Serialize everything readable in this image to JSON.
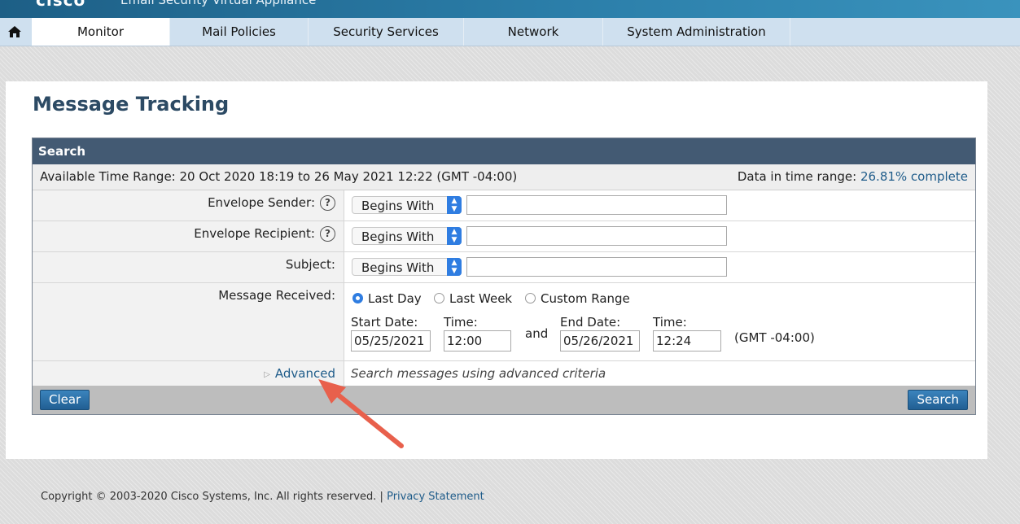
{
  "header": {
    "logo": "cisco",
    "product": "Email Security Virtual Appliance"
  },
  "nav": {
    "home_icon": "home-icon",
    "tabs": [
      "Monitor",
      "Mail Policies",
      "Security Services",
      "Network",
      "System Administration"
    ],
    "active_tab": "Monitor"
  },
  "page": {
    "title": "Message Tracking"
  },
  "search": {
    "heading": "Search",
    "available_range": "Available Time Range: 20 Oct 2020 18:19 to 26 May 2021 12:22 (GMT -04:00)",
    "data_range_label": "Data in time range:",
    "data_range_value": "26.81% complete",
    "fields": [
      {
        "label": "Envelope Sender:",
        "help": "?",
        "operator": "Begins With",
        "value": ""
      },
      {
        "label": "Envelope Recipient:",
        "help": "?",
        "operator": "Begins With",
        "value": ""
      },
      {
        "label": "Subject:",
        "operator": "Begins With",
        "value": ""
      }
    ],
    "received": {
      "label": "Message Received:",
      "options": [
        "Last Day",
        "Last Week",
        "Custom Range"
      ],
      "selected": "Last Day",
      "start_date_label": "Start Date:",
      "start_date": "05/25/2021",
      "start_time_label": "Time:",
      "start_time": "12:00",
      "and_label": "and",
      "end_date_label": "End Date:",
      "end_date": "05/26/2021",
      "end_time_label": "Time:",
      "end_time": "12:24",
      "tz": "(GMT -04:00)"
    },
    "advanced": {
      "label": "Advanced",
      "hint": "Search messages using advanced criteria"
    },
    "clear_label": "Clear",
    "search_label": "Search"
  },
  "footer": {
    "copyright": "Copyright © 2003-2020 Cisco Systems, Inc. All rights reserved. |",
    "privacy": "Privacy Statement"
  },
  "colors": {
    "nav_bg": "#cfe0ef",
    "box_header": "#435a73",
    "link": "#1f5c8a",
    "annotation_arrow": "#e8604c"
  }
}
